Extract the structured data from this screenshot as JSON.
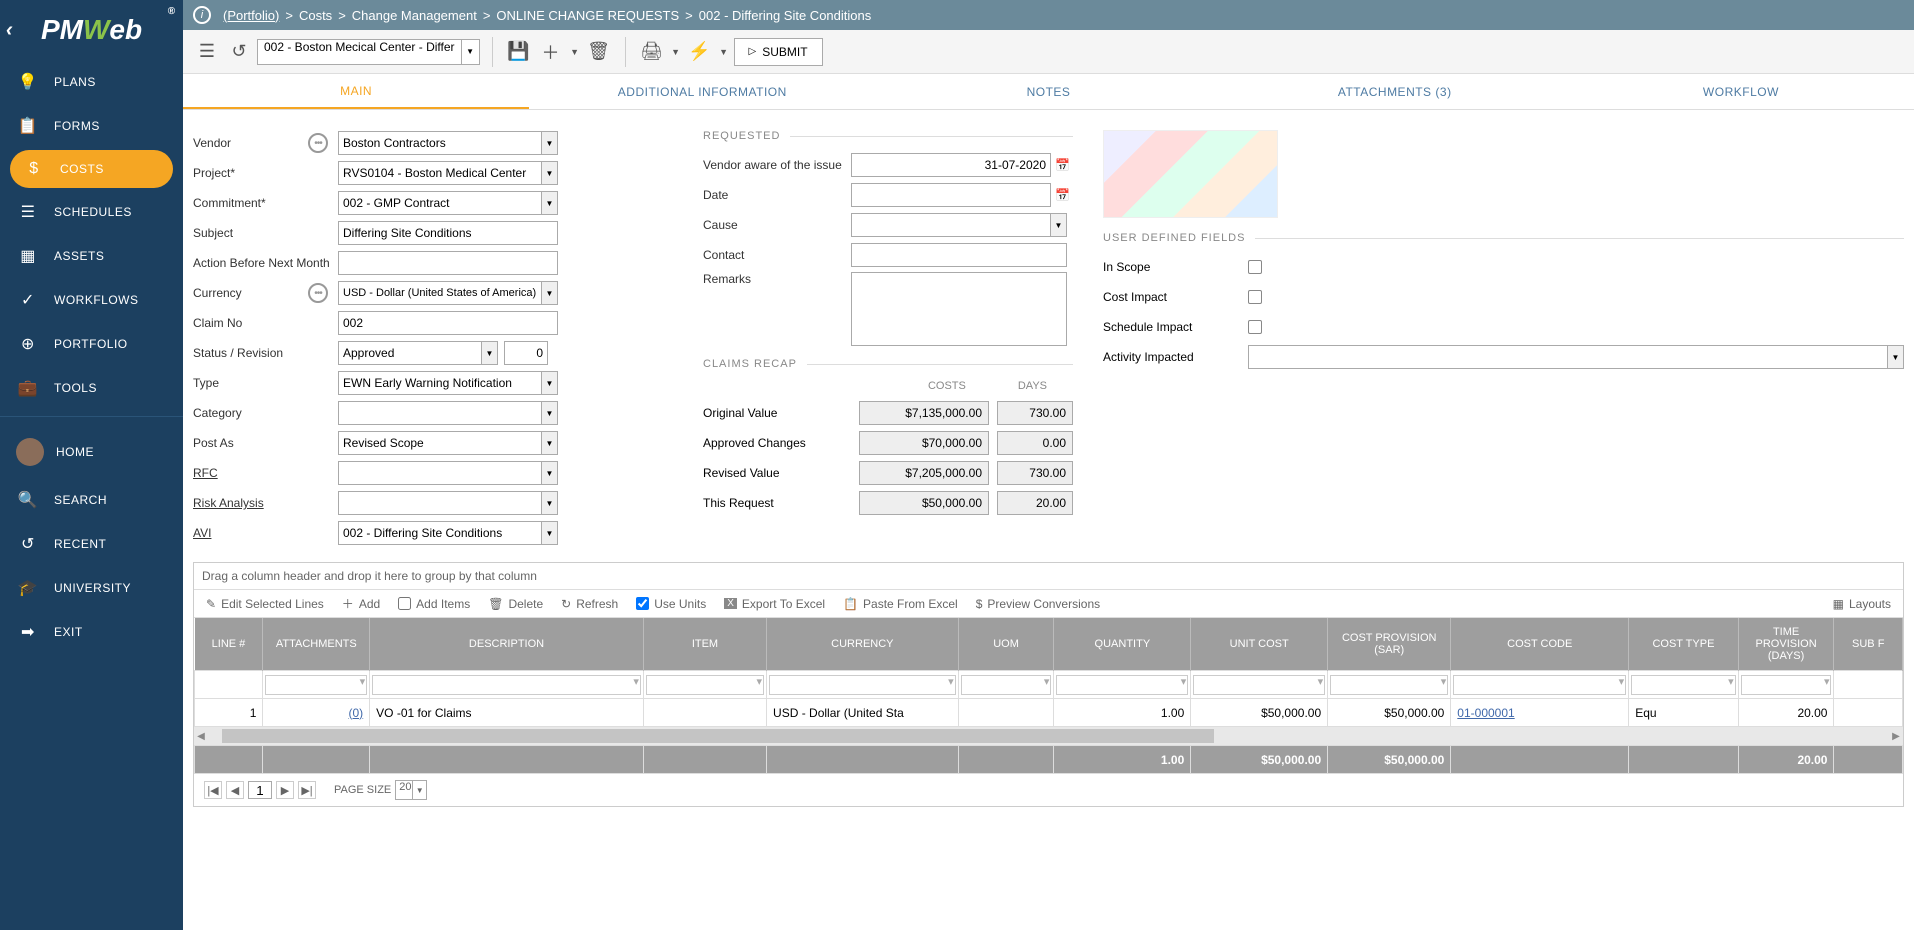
{
  "logo": {
    "pre": "PM",
    "accent": "W",
    "post": "eb",
    "reg": "®"
  },
  "sidebar": {
    "items": [
      {
        "icon": "💡",
        "label": "PLANS"
      },
      {
        "icon": "📋",
        "label": "FORMS"
      },
      {
        "icon": "$",
        "label": "COSTS"
      },
      {
        "icon": "☰",
        "label": "SCHEDULES"
      },
      {
        "icon": "▦",
        "label": "ASSETS"
      },
      {
        "icon": "✓",
        "label": "WORKFLOWS"
      },
      {
        "icon": "⊕",
        "label": "PORTFOLIO"
      },
      {
        "icon": "💼",
        "label": "TOOLS"
      }
    ],
    "items2": [
      {
        "icon": "",
        "label": "HOME"
      },
      {
        "icon": "🔍",
        "label": "SEARCH"
      },
      {
        "icon": "↺",
        "label": "RECENT"
      },
      {
        "icon": "🎓",
        "label": "UNIVERSITY"
      },
      {
        "icon": "➡",
        "label": "EXIT"
      }
    ]
  },
  "breadcrumb": {
    "root": "(Portfolio)",
    "parts": [
      "Costs",
      "Change Management",
      "ONLINE CHANGE REQUESTS",
      "002 - Differing Site Conditions"
    ]
  },
  "toolbar": {
    "record_select": "002 - Boston Mecical Center - Differ",
    "submit": "SUBMIT"
  },
  "tabs": [
    "MAIN",
    "ADDITIONAL INFORMATION",
    "NOTES",
    "ATTACHMENTS (3)",
    "WORKFLOW"
  ],
  "form": {
    "vendor_label": "Vendor",
    "vendor": "Boston Contractors",
    "project_label": "Project*",
    "project": "RVS0104 - Boston Medical Center",
    "commitment_label": "Commitment*",
    "commitment": "002 - GMP Contract",
    "subject_label": "Subject",
    "subject": "Differing Site Conditions",
    "action_label": "Action Before Next Month",
    "action": "",
    "currency_label": "Currency",
    "currency": "USD - Dollar (United States of America)",
    "claimno_label": "Claim No",
    "claimno": "002",
    "status_label": "Status / Revision",
    "status": "Approved",
    "revision": "0",
    "type_label": "Type",
    "type": "EWN Early Warning Notification",
    "category_label": "Category",
    "category": "",
    "postas_label": "Post As",
    "postas": "Revised Scope",
    "rfc_label": "RFC",
    "rfc": "",
    "risk_label": "Risk Analysis",
    "risk": "",
    "avi_label": "AVI",
    "avi": "002 - Differing Site Conditions"
  },
  "requested": {
    "header": "REQUESTED",
    "aware_label": "Vendor aware of the issue",
    "aware": "31-07-2020",
    "date_label": "Date",
    "date": "",
    "cause_label": "Cause",
    "cause": "",
    "contact_label": "Contact",
    "contact": "",
    "remarks_label": "Remarks",
    "remarks": ""
  },
  "recap": {
    "header": "CLAIMS RECAP",
    "costs_h": "COSTS",
    "days_h": "DAYS",
    "rows": [
      {
        "label": "Original Value",
        "cost": "$7,135,000.00",
        "days": "730.00"
      },
      {
        "label": "Approved Changes",
        "cost": "$70,000.00",
        "days": "0.00"
      },
      {
        "label": "Revised Value",
        "cost": "$7,205,000.00",
        "days": "730.00"
      },
      {
        "label": "This Request",
        "cost": "$50,000.00",
        "days": "20.00"
      }
    ]
  },
  "udf": {
    "header": "USER DEFINED FIELDS",
    "scope": "In Scope",
    "cost": "Cost Impact",
    "schedule": "Schedule Impact",
    "activity": "Activity Impacted"
  },
  "grid": {
    "hint": "Drag a column header and drop it here to group by that column",
    "tb": {
      "edit": "Edit Selected Lines",
      "add": "Add",
      "add_items": "Add Items",
      "delete": "Delete",
      "refresh": "Refresh",
      "use_units": "Use Units",
      "export": "Export To Excel",
      "paste": "Paste From Excel",
      "preview": "Preview Conversions",
      "layouts": "Layouts"
    },
    "cols": [
      "LINE #",
      "ATTACHMENTS",
      "DESCRIPTION",
      "ITEM",
      "CURRENCY",
      "UOM",
      "QUANTITY",
      "UNIT COST",
      "COST PROVISION (SAR)",
      "COST CODE",
      "COST TYPE",
      "TIME PROVISION (DAYS)",
      "SUB F"
    ],
    "row": {
      "line": "1",
      "att": "(0)",
      "desc": "VO -01 for Claims",
      "item": "",
      "currency": "USD - Dollar (United Sta",
      "uom": "",
      "qty": "1.00",
      "unit_cost": "$50,000.00",
      "provision": "$50,000.00",
      "code": "01-000001",
      "type": "Equ",
      "time": "20.00"
    },
    "totals": {
      "qty": "1.00",
      "unit_cost": "$50,000.00",
      "provision": "$50,000.00",
      "time": "20.00"
    },
    "pager": {
      "page_size_label": "PAGE SIZE",
      "page": "1",
      "size": "20"
    }
  }
}
